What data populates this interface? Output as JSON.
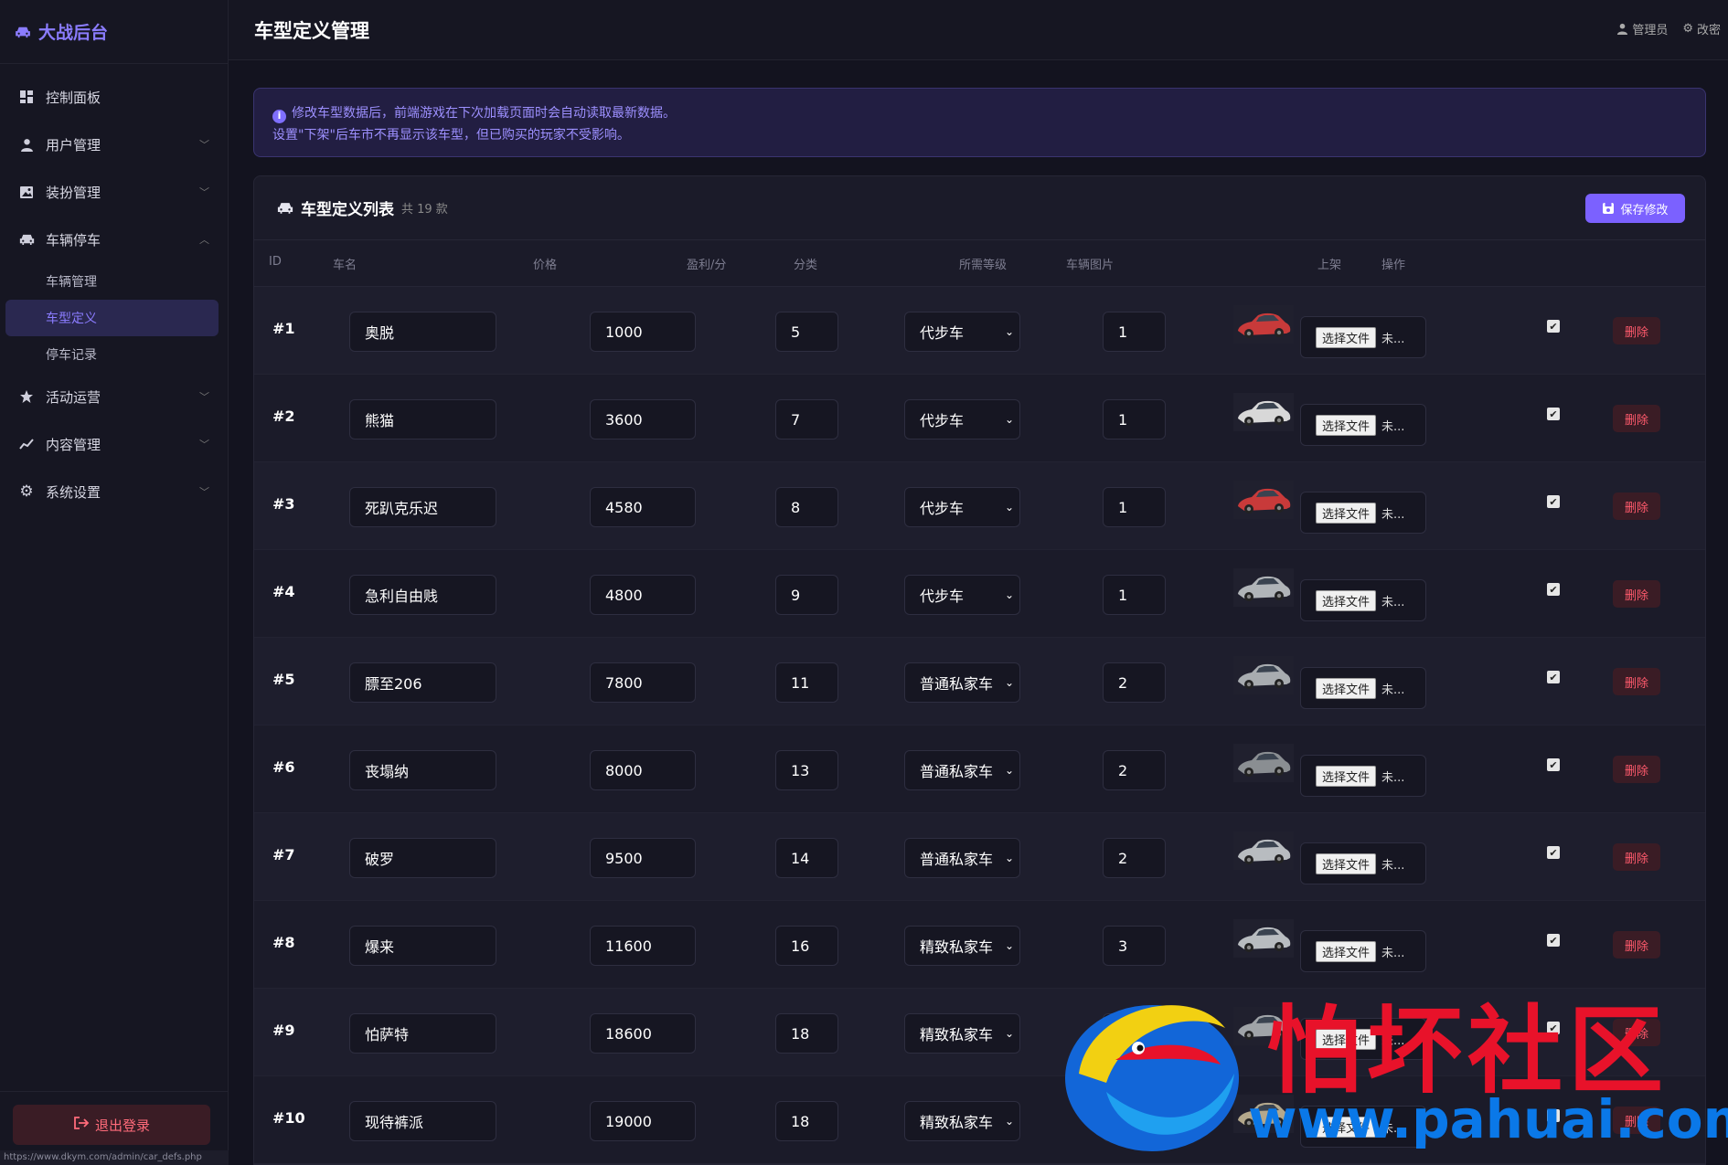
{
  "brand": "大战后台",
  "sidebar": {
    "items": [
      {
        "label": "控制面板",
        "icon": "dashboard-icon",
        "chevron": ""
      },
      {
        "label": "用户管理",
        "icon": "user-icon",
        "chevron": "﹀"
      },
      {
        "label": "装扮管理",
        "icon": "image-icon",
        "chevron": "﹀"
      },
      {
        "label": "车辆停车",
        "icon": "car-icon",
        "chevron": "︿"
      },
      {
        "label": "活动运营",
        "icon": "star-icon",
        "chevron": "﹀"
      },
      {
        "label": "内容管理",
        "icon": "chart-line-icon",
        "chevron": "﹀"
      },
      {
        "label": "系统设置",
        "icon": "gear-icon",
        "chevron": "﹀"
      }
    ],
    "sub_items": [
      {
        "label": "车辆管理",
        "active": false
      },
      {
        "label": "车型定义",
        "active": true
      },
      {
        "label": "停车记录",
        "active": false
      }
    ],
    "logout": "退出登录",
    "status_url": "https://www.dkym.com/admin/car_defs.php"
  },
  "header": {
    "title": "车型定义管理",
    "user": "管理员",
    "change": "改密"
  },
  "notice": {
    "line1": "修改车型数据后，前端游戏在下次加载页面时会自动读取最新数据。",
    "line2": "设置\"下架\"后车市不再显示该车型，但已购买的玩家不受影响。"
  },
  "card": {
    "title": "车型定义列表",
    "count": "共 19 款",
    "save": "保存修改"
  },
  "columns": [
    "ID",
    "车名",
    "价格",
    "盈利/分",
    "分类",
    "所需等级",
    "车辆图片",
    "上架",
    "操作"
  ],
  "file_button": "选择文件",
  "file_status": "未...",
  "delete_label": "删除",
  "rows": [
    {
      "id": "#1",
      "name": "奥脱",
      "price": "1000",
      "profit": "5",
      "category": "代步车",
      "level": "1",
      "color": "#c83a3a"
    },
    {
      "id": "#2",
      "name": "熊猫",
      "price": "3600",
      "profit": "7",
      "category": "代步车",
      "level": "1",
      "color": "#d8d8d8"
    },
    {
      "id": "#3",
      "name": "死趴克乐迟",
      "price": "4580",
      "profit": "8",
      "category": "代步车",
      "level": "1",
      "color": "#c83a3a"
    },
    {
      "id": "#4",
      "name": "急利自由贱",
      "price": "4800",
      "profit": "9",
      "category": "代步车",
      "level": "1",
      "color": "#b0b4b8"
    },
    {
      "id": "#5",
      "name": "膘至206",
      "price": "7800",
      "profit": "11",
      "category": "普通私家车",
      "level": "2",
      "color": "#a8acb0"
    },
    {
      "id": "#6",
      "name": "丧塌纳",
      "price": "8000",
      "profit": "13",
      "category": "普通私家车",
      "level": "2",
      "color": "#8a8e92"
    },
    {
      "id": "#7",
      "name": "破罗",
      "price": "9500",
      "profit": "14",
      "category": "普通私家车",
      "level": "2",
      "color": "#b8bcc0"
    },
    {
      "id": "#8",
      "name": "爆来",
      "price": "11600",
      "profit": "16",
      "category": "精致私家车",
      "level": "3",
      "color": "#b8bcc0"
    },
    {
      "id": "#9",
      "name": "怕萨特",
      "price": "18600",
      "profit": "18",
      "category": "精致私家车",
      "level": "",
      "color": "#a0a4a8"
    },
    {
      "id": "#10",
      "name": "现待裤派",
      "price": "19000",
      "profit": "18",
      "category": "精致私家车",
      "level": "",
      "color": "#b4a88c"
    }
  ],
  "watermark": {
    "text": "怕坏社区",
    "url": "www.pahuai.com"
  }
}
